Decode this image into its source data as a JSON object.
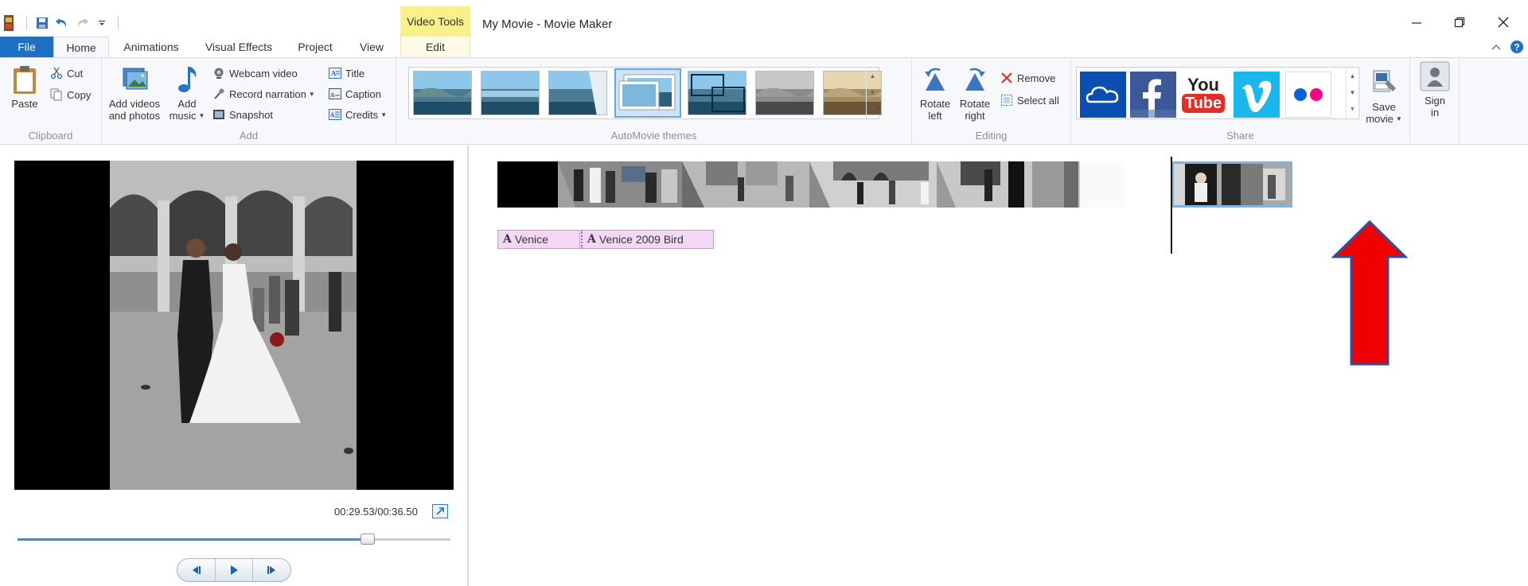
{
  "window": {
    "title": "My Movie - Movie Maker",
    "context_tab_group": "Video Tools"
  },
  "tabs": [
    {
      "label": "File"
    },
    {
      "label": "Home"
    },
    {
      "label": "Animations"
    },
    {
      "label": "Visual Effects"
    },
    {
      "label": "Project"
    },
    {
      "label": "View"
    },
    {
      "label": "Edit"
    }
  ],
  "ribbon": {
    "clipboard": {
      "label": "Clipboard",
      "paste": "Paste",
      "cut": "Cut",
      "copy": "Copy"
    },
    "add": {
      "label": "Add",
      "add_videos_line1": "Add videos",
      "add_videos_line2": "and photos",
      "add_music_line1": "Add",
      "add_music_line2": "music",
      "webcam_video": "Webcam video",
      "record_narration": "Record narration",
      "snapshot": "Snapshot",
      "title": "Title",
      "caption": "Caption",
      "credits": "Credits"
    },
    "themes": {
      "label": "AutoMovie themes"
    },
    "editing": {
      "label": "Editing",
      "rotate_left_1": "Rotate",
      "rotate_left_2": "left",
      "rotate_right_1": "Rotate",
      "rotate_right_2": "right",
      "remove": "Remove",
      "select_all": "Select all"
    },
    "share": {
      "label": "Share",
      "youtube_line1": "You",
      "youtube_line2": "Tube",
      "save_movie_1": "Save",
      "save_movie_2": "movie",
      "sign_in_1": "Sign",
      "sign_in_2": "in"
    }
  },
  "preview": {
    "timecode": "00:29.53/00:36.50",
    "progress_fraction": 0.809
  },
  "storyboard": {
    "captions": [
      {
        "text": "Venice"
      },
      {
        "text": "Venice 2009 Bird"
      }
    ]
  },
  "colors": {
    "file_tab": "#1f6fc5",
    "context_tab": "#f9ef8b",
    "caption_chip": "#f3d8f5",
    "selection": "#7db4e4",
    "arrow_fill": "#f20000",
    "arrow_border": "#2f4f9c"
  }
}
